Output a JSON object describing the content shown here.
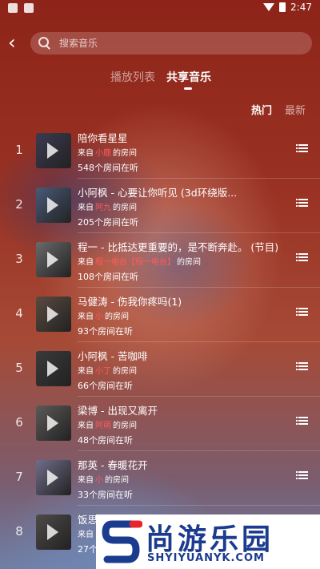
{
  "status_bar": {
    "time": "2:47"
  },
  "search": {
    "placeholder": "搜索音乐"
  },
  "tabs": [
    {
      "label": "播放列表",
      "active": false
    },
    {
      "label": "共享音乐",
      "active": true
    }
  ],
  "sort": {
    "hot": "热门",
    "new": "最新",
    "active": "hot"
  },
  "songs": [
    {
      "rank": "1",
      "title": "陪你看星星",
      "from_prefix": "来自",
      "room_name": "小鹿",
      "room_suffix": "的房间",
      "listeners": "548个房间在听"
    },
    {
      "rank": "2",
      "title": "小阿枫 - 心要让你听见 (3d环绕版...",
      "from_prefix": "来自",
      "room_name": "阿九",
      "room_suffix": "的房间",
      "listeners": "205个房间在听"
    },
    {
      "rank": "3",
      "title": "程一 - 比抵达更重要的，是不断奔赴。 (节目)",
      "from_prefix": "来自",
      "room_name": "程一电台【程一电台】",
      "room_suffix": "的房间",
      "listeners": "108个房间在听"
    },
    {
      "rank": "4",
      "title": "马健涛 - 伤我你疼吗(1)",
      "from_prefix": "来自",
      "room_name": "小",
      "room_suffix": "的房间",
      "listeners": "93个房间在听"
    },
    {
      "rank": "5",
      "title": "小阿枫 - 苦咖啡",
      "from_prefix": "来自",
      "room_name": "小丁",
      "room_suffix": "的房间",
      "listeners": "66个房间在听"
    },
    {
      "rank": "6",
      "title": "梁博 - 出现又离开",
      "from_prefix": "来自",
      "room_name": "阿萌",
      "room_suffix": "的房间",
      "listeners": "48个房间在听"
    },
    {
      "rank": "7",
      "title": "那英 - 春暖花开",
      "from_prefix": "来自",
      "room_name": "小",
      "room_suffix": "的房间",
      "listeners": "33个房间在听"
    },
    {
      "rank": "8",
      "title": "饭思",
      "from_prefix": "来自",
      "room_name": "",
      "room_suffix": "",
      "listeners": "27个"
    }
  ],
  "watermark": {
    "title": "尚游乐园",
    "url": "SHYIYUANYK.COM"
  },
  "colors": {
    "room_name": "#ff5a5a",
    "watermark_blue": "#1b3b8f"
  }
}
